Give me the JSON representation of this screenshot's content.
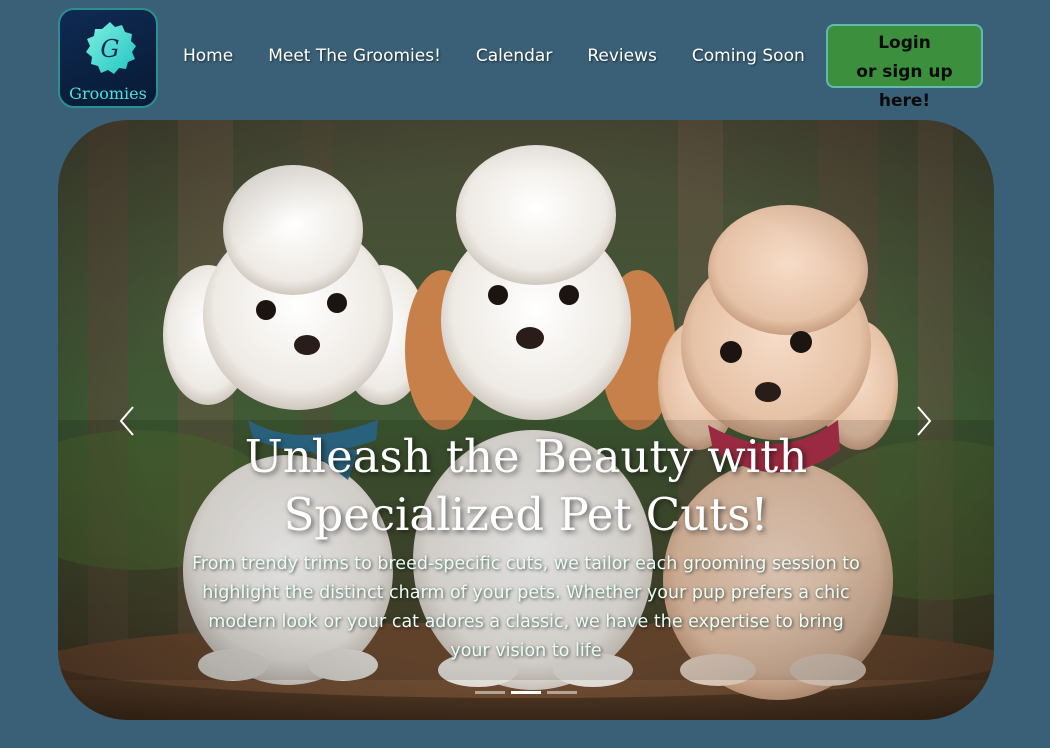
{
  "brand": {
    "name": "Groomies",
    "logo_letter": "G"
  },
  "nav": [
    {
      "label": "Home"
    },
    {
      "label": "Meet The Groomies!"
    },
    {
      "label": "Calendar"
    },
    {
      "label": "Reviews"
    },
    {
      "label": "Coming Soon"
    }
  ],
  "login": {
    "line1": "Login",
    "line2": "or sign up here!"
  },
  "hero": {
    "title_line1": "Unleash the Beauty with",
    "title_line2": "Specialized Pet Cuts!",
    "description": "From trendy trims to breed-specific cuts, we tailor each grooming session to highlight the distinct charm of your pets. Whether your pup prefers a chic modern look or your cat adores a classic, we have the expertise to bring your vision to life",
    "slides_total": 3,
    "active_slide": 2,
    "image_icon": "three-poodle-puppies-photo"
  },
  "colors": {
    "background": "#3a6077",
    "login_green": "#3c8f3c",
    "logo_teal": "#4fe0d8"
  }
}
